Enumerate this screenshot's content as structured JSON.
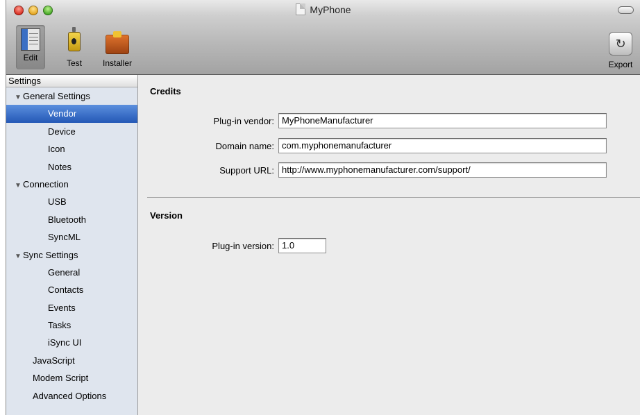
{
  "window": {
    "title": "MyPhone"
  },
  "toolbar": {
    "edit_label": "Edit",
    "test_label": "Test",
    "installer_label": "Installer",
    "export_label": "Export"
  },
  "sidebar": {
    "header": "Settings",
    "items": [
      {
        "label": "General Settings",
        "level": 0,
        "expanded": true
      },
      {
        "label": "Vendor",
        "level": 1,
        "selected": true
      },
      {
        "label": "Device",
        "level": 1
      },
      {
        "label": "Icon",
        "level": 1
      },
      {
        "label": "Notes",
        "level": 1
      },
      {
        "label": "Connection",
        "level": 0,
        "expanded": true
      },
      {
        "label": "USB",
        "level": 1
      },
      {
        "label": "Bluetooth",
        "level": 1
      },
      {
        "label": "SyncML",
        "level": 1
      },
      {
        "label": "Sync Settings",
        "level": 0,
        "expanded": true
      },
      {
        "label": "General",
        "level": 1
      },
      {
        "label": "Contacts",
        "level": 1
      },
      {
        "label": "Events",
        "level": 1
      },
      {
        "label": "Tasks",
        "level": 1
      },
      {
        "label": "iSync UI",
        "level": 1
      },
      {
        "label": "JavaScript",
        "level": 0
      },
      {
        "label": "Modem Script",
        "level": 0
      },
      {
        "label": "Advanced Options",
        "level": 0
      }
    ]
  },
  "credits": {
    "title": "Credits",
    "vendor_label": "Plug-in vendor:",
    "vendor_value": "MyPhoneManufacturer",
    "domain_label": "Domain name:",
    "domain_value": "com.myphonemanufacturer",
    "url_label": "Support URL:",
    "url_value": "http://www.myphonemanufacturer.com/support/"
  },
  "version": {
    "title": "Version",
    "label": "Plug-in version:",
    "value": "1.0"
  },
  "colors": {
    "selection": "#2f63c4",
    "sidebar_bg": "#dfe5ee",
    "content_bg": "#ececec"
  }
}
